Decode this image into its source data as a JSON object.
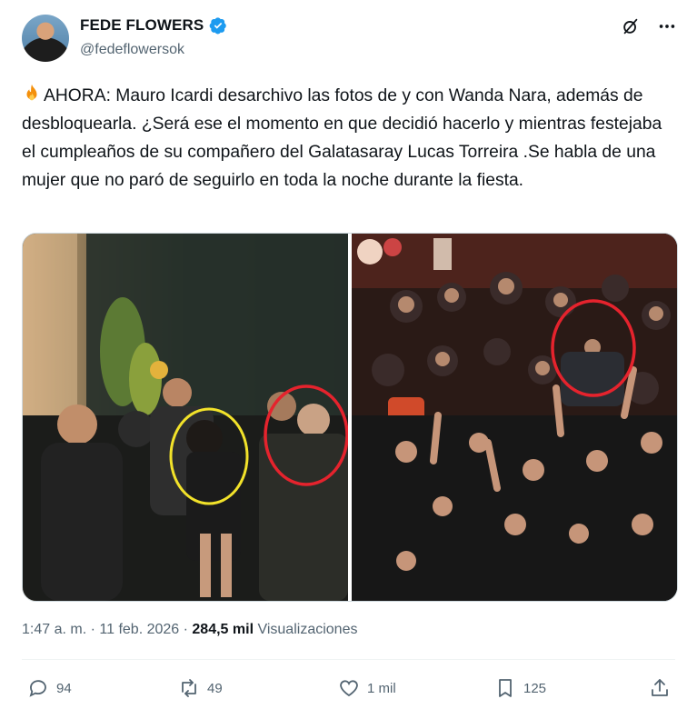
{
  "author": {
    "display_name": "FEDE FLOWERS",
    "handle": "@fedeflowersok",
    "verified": true
  },
  "header_icons": [
    "grok-icon",
    "more-icon"
  ],
  "tweet": {
    "text": "AHORA: Mauro Icardi desarchivo las fotos de y con Wanda Nara, además de desbloquearla. ¿Será ese el momento en que decidió hacerlo y mientras festejaba el cumpleaños de su compañero del Galatasaray Lucas Torreira .Se habla de una mujer que no paró de seguirlo en toda la noche durante la fiesta.",
    "emoji": "fire-icon"
  },
  "media": {
    "photos": [
      "party-photo-left",
      "party-photo-right"
    ],
    "highlight_colors": {
      "yellow": "#f2e22a",
      "red": "#e5232d"
    }
  },
  "meta": {
    "time": "1:47 a. m.",
    "dot1": "·",
    "date": "11 feb. 2026",
    "dot2": "·",
    "views_count": "284,5 mil",
    "views_label": "Visualizaciones"
  },
  "actions": {
    "replies": "94",
    "reposts": "49",
    "likes": "1 mil",
    "bookmarks": "125"
  },
  "colors": {
    "text": "#0f1419",
    "secondary": "#536471",
    "verified": "#1d9bf0"
  }
}
